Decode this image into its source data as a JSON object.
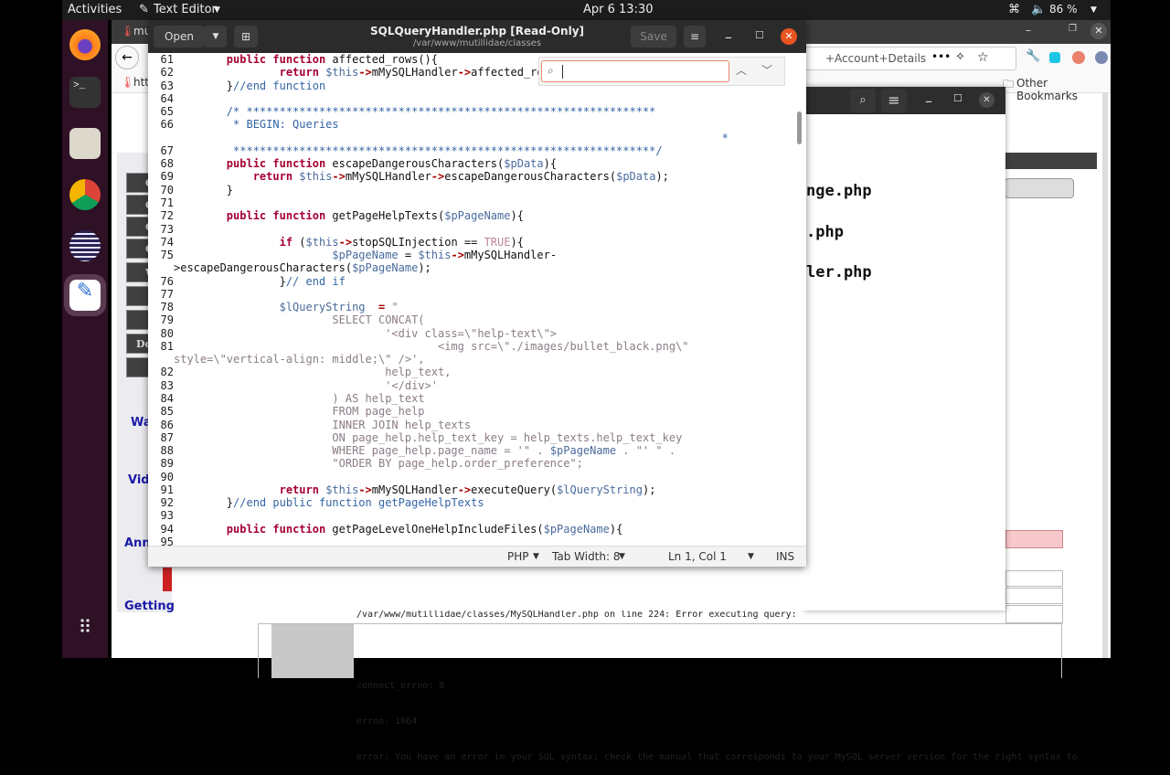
{
  "topbar": {
    "activities": "Activities",
    "app": "Text Editor",
    "clock": "Apr 6  13:30",
    "battery": "86 %"
  },
  "browser": {
    "tab1": "mu",
    "url_tail": "+Account+Details",
    "bookmark_tail": "htt",
    "other_bookmarks": "Other Bookmarks",
    "side_menu": [
      "O",
      "O",
      "O",
      "O",
      "W",
      "",
      "",
      "Do",
      ""
    ],
    "side_links": [
      "Wa",
      "Vid",
      "Ann",
      "Getting"
    ],
    "error_lines": [
      "/var/www/mutillidae/classes/MySQLHandler.php on line 224: Error executing query:",
      "",
      "connect_errno: 0",
      "errno: 1064",
      "error: You have an error in your SQL syntax; check the manual that corresponds to your MySQL server version for the right syntax to"
    ]
  },
  "file_window": {
    "files": [
      "nge.php",
      ".php",
      "ler.php"
    ]
  },
  "editor": {
    "title": "SQLQueryHandler.php [Read-Only]",
    "subtitle": "/var/www/mutillidae/classes",
    "open": "Open",
    "save": "Save",
    "search_value": "",
    "status": {
      "language": "PHP",
      "tab_width": "Tab Width: 8",
      "position": "Ln 1, Col 1",
      "mode": "INS"
    },
    "lines": [
      {
        "n": "61",
        "t": "        public function affected_rows(){"
      },
      {
        "n": "62",
        "t": "                return $this->mMySQLHandler->affected_rows();"
      },
      {
        "n": "63",
        "t": "        }//end function"
      },
      {
        "n": "64",
        "t": ""
      },
      {
        "n": "65",
        "t": "        /* **************************************************************",
        "c": 1
      },
      {
        "n": "66",
        "t": "         * BEGIN: Queries",
        "c": 1
      },
      {
        "n": "",
        "t": "                                                                                   *",
        "c": 1
      },
      {
        "n": "67",
        "t": "         ****************************************************************/",
        "c": 1
      },
      {
        "n": "68",
        "t": "        public function escapeDangerousCharacters($pData){"
      },
      {
        "n": "69",
        "t": "            return $this->mMySQLHandler->escapeDangerousCharacters($pData);"
      },
      {
        "n": "70",
        "t": "        }"
      },
      {
        "n": "71",
        "t": ""
      },
      {
        "n": "72",
        "t": "        public function getPageHelpTexts($pPageName){"
      },
      {
        "n": "73",
        "t": ""
      },
      {
        "n": "74",
        "t": "                if ($this->stopSQLInjection == TRUE){"
      },
      {
        "n": "75",
        "t": "                        $pPageName = $this->mMySQLHandler-"
      },
      {
        "n": "",
        "t": ">escapeDangerousCharacters($pPageName);"
      },
      {
        "n": "76",
        "t": "                }// end if"
      },
      {
        "n": "77",
        "t": ""
      },
      {
        "n": "78",
        "t": "                $lQueryString  = \"",
        "s": 1
      },
      {
        "n": "79",
        "t": "                        SELECT CONCAT(",
        "s": 1
      },
      {
        "n": "80",
        "t": "                                '<div class=\\\"help-text\\\">",
        "s": 1
      },
      {
        "n": "81",
        "t": "                                        <img src=\\\"./images/bullet_black.png\\\"",
        "s": 1
      },
      {
        "n": "",
        "t": "style=\\\"vertical-align: middle;\\\" />',",
        "s": 1
      },
      {
        "n": "82",
        "t": "                                help_text,",
        "s": 1
      },
      {
        "n": "83",
        "t": "                                '</div>'",
        "s": 1
      },
      {
        "n": "84",
        "t": "                        ) AS help_text",
        "s": 1
      },
      {
        "n": "85",
        "t": "                        FROM page_help",
        "s": 1
      },
      {
        "n": "86",
        "t": "                        INNER JOIN help_texts",
        "s": 1
      },
      {
        "n": "87",
        "t": "                        ON page_help.help_text_key = help_texts.help_text_key",
        "s": 1
      },
      {
        "n": "88",
        "t": "                        WHERE page_help.page_name = '\" . $pPageName . \"' \" .",
        "s": 1
      },
      {
        "n": "89",
        "t": "                        \"ORDER BY page_help.order_preference\";",
        "s": 1
      },
      {
        "n": "90",
        "t": ""
      },
      {
        "n": "91",
        "t": "                return $this->mMySQLHandler->executeQuery($lQueryString);"
      },
      {
        "n": "92",
        "t": "        }//end public function getPageHelpTexts"
      },
      {
        "n": "93",
        "t": ""
      },
      {
        "n": "94",
        "t": "        public function getPageLevelOneHelpIncludeFiles($pPageName){"
      },
      {
        "n": "95",
        "t": ""
      }
    ]
  },
  "colors": {
    "keyword": "#a40032",
    "variable": "#4a6b9c",
    "comment": "#3465a4",
    "string": "#8b7c88",
    "close_button": "#e95420"
  }
}
